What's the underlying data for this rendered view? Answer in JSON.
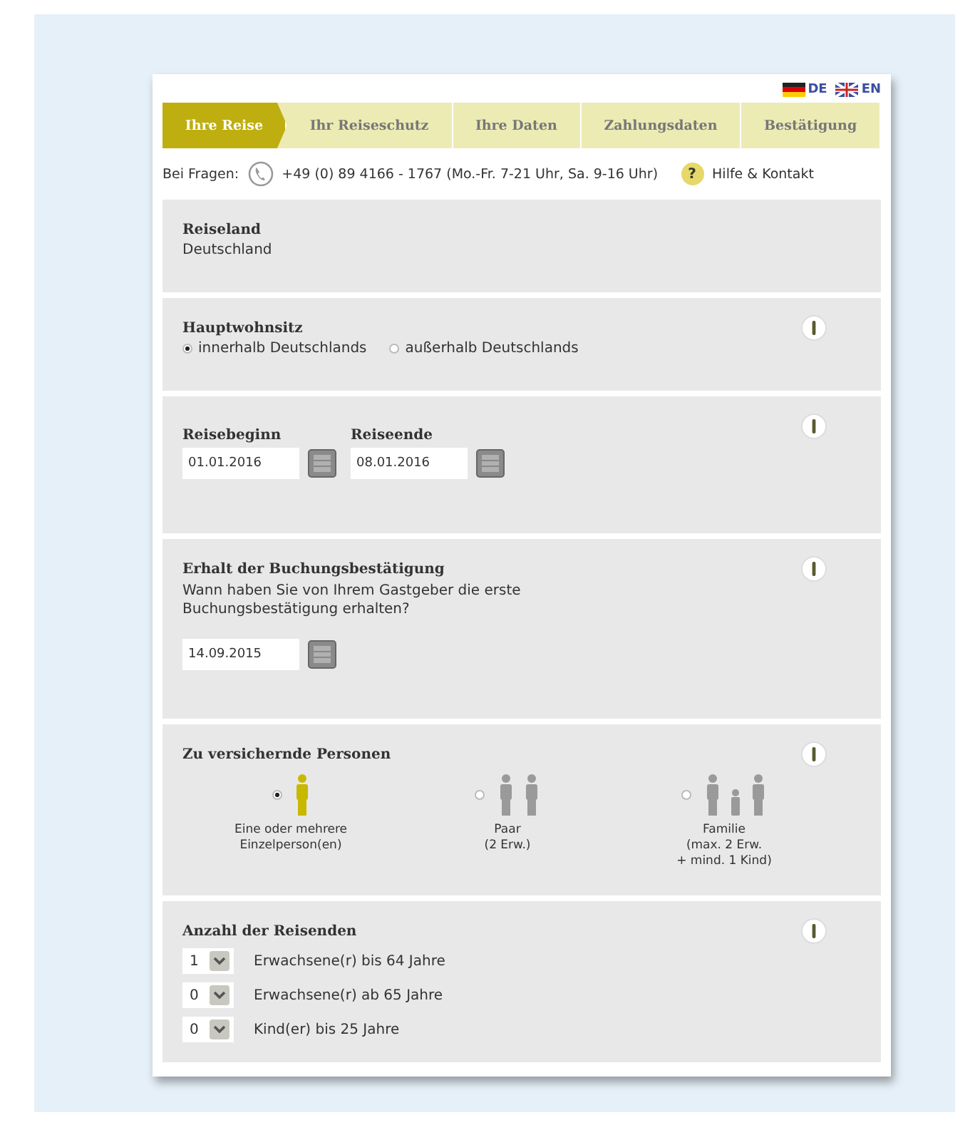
{
  "languages": [
    {
      "kind": "de",
      "label": "DE"
    },
    {
      "kind": "gb",
      "label": "EN"
    }
  ],
  "steps": [
    {
      "label": "Ihre Reise",
      "selected": true
    },
    {
      "label": "Ihr Reiseschutz",
      "selected": false
    },
    {
      "label": "Ihre Daten",
      "selected": false
    },
    {
      "label": "Zahlungsdaten",
      "selected": false
    },
    {
      "label": "Bestätigung",
      "selected": false
    }
  ],
  "contact": {
    "label": "Bei Fragen:",
    "phone": "+49 (0) 89 4166 - 1767 (Mo.-Fr. 7-21 Uhr, Sa. 9-16 Uhr)",
    "help_icon": "?",
    "help": "Hilfe & Kontakt"
  },
  "sections": [
    {
      "kind": "text",
      "title": "Reiseland",
      "info": false,
      "value": "Deutschland"
    },
    {
      "kind": "radio",
      "title": "Hauptwohnsitz",
      "info": true,
      "options": [
        {
          "label": "innerhalb Deutschlands",
          "selected": true
        },
        {
          "label": "außerhalb Deutschlands",
          "selected": false
        }
      ]
    },
    {
      "kind": "dates",
      "info": true,
      "fields": [
        {
          "label": "Reisebeginn",
          "value": "01.01.2016"
        },
        {
          "label": "Reiseende",
          "value": "08.01.2016"
        }
      ]
    },
    {
      "kind": "date",
      "title": "Erhalt der Buchungsbestätigung",
      "info": true,
      "text": "Wann haben Sie von Ihrem Gastgeber die erste Buchungsbestätigung erhalten?",
      "value": "14.09.2015"
    },
    {
      "kind": "persons",
      "title": "Zu versichernde Personen",
      "info": true,
      "options": [
        {
          "kind": "single",
          "lines": [
            "Eine oder mehrere",
            "Einzelperson(en)"
          ],
          "selected": true
        },
        {
          "kind": "couple",
          "lines": [
            "Paar",
            "(2 Erw.)"
          ],
          "selected": false
        },
        {
          "kind": "family",
          "lines": [
            "Familie",
            "(max. 2 Erw.",
            "+ mind. 1 Kind)"
          ],
          "selected": false
        }
      ]
    },
    {
      "kind": "counts",
      "title": "Anzahl der Reisenden",
      "info": true,
      "rows": [
        {
          "value": "1",
          "label": "Erwachsene(r) bis 64 Jahre"
        },
        {
          "value": "0",
          "label": "Erwachsene(r) ab 65 Jahre"
        },
        {
          "value": "0",
          "label": "Kind(er) bis 25 Jahre"
        }
      ]
    }
  ]
}
